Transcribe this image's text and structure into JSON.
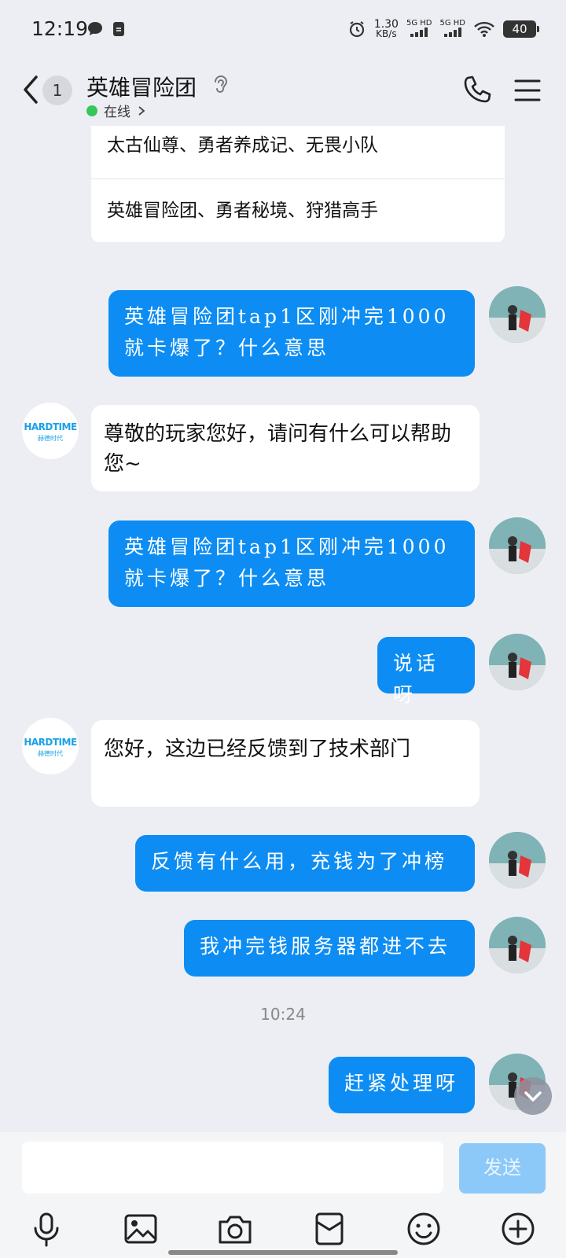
{
  "status_bar": {
    "time": "12:19",
    "speed_value": "1.30",
    "speed_unit": "KB/s",
    "net1": "5G HD",
    "net2": "5G HD",
    "battery": "40"
  },
  "header": {
    "back_badge": "1",
    "title": "英雄冒险团",
    "status": "在线"
  },
  "card": {
    "rows": [
      "太古仙尊、勇者养成记、无畏小队",
      "英雄冒险团、勇者秘境、狩猎高手"
    ]
  },
  "messages": [
    {
      "side": "right",
      "text": "英雄冒险团tap1区刚冲完1000就卡爆了？什么意思"
    },
    {
      "side": "left",
      "text": "尊敬的玩家您好，请问有什么可以帮助您~"
    },
    {
      "side": "right",
      "text": "英雄冒险团tap1区刚冲完1000就卡爆了？什么意思"
    },
    {
      "side": "right",
      "text": "说话呀"
    },
    {
      "side": "left",
      "text": "您好，这边已经反馈到了技术部门"
    },
    {
      "side": "right",
      "text": "反馈有什么用，充钱为了冲榜"
    },
    {
      "side": "right",
      "text": "我冲完钱服务器都进不去"
    },
    {
      "side": "right",
      "text": "赶紧处理呀"
    }
  ],
  "time_divider": "10:24",
  "bot_avatar": {
    "logo": "HARDTIME",
    "sub": "赫德时代"
  },
  "composer": {
    "placeholder": "",
    "send_label": "发送"
  },
  "toolbar": [
    "mic-icon",
    "image-icon",
    "camera-icon",
    "red-packet-icon",
    "emoji-icon",
    "plus-icon"
  ]
}
